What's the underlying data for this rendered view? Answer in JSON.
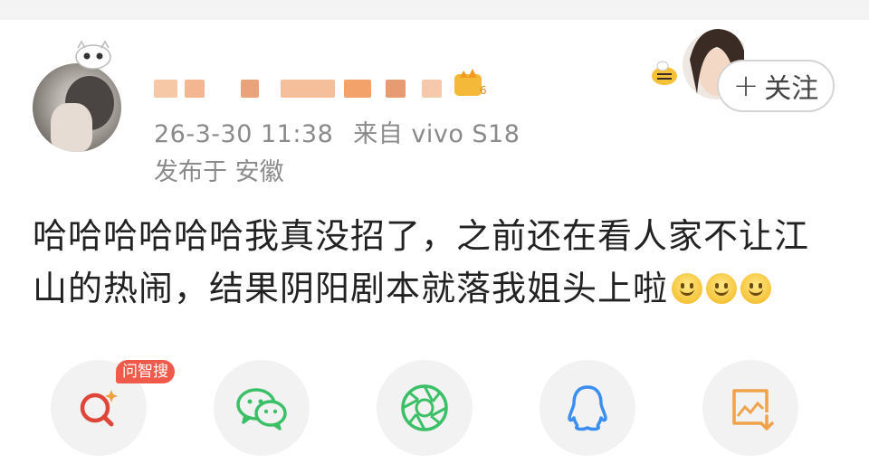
{
  "post": {
    "username_obscured": true,
    "timestamp": "26-3-30 11:38",
    "source": "来自 vivo S18",
    "location": "发布于 安徽",
    "follow_label": "关注",
    "text_line1": "哈哈哈哈哈哈我真没招了，之前还在看人家不让江",
    "text_line2": "山的热闹，结果阴阳剧本就落我姐头上啦",
    "emoji": "smile-emoji"
  },
  "share": {
    "ai_badge": "问智搜",
    "buttons": [
      {
        "name": "ai-search",
        "icon": "magnifier-sparkle-icon",
        "color": "#e0453a"
      },
      {
        "name": "wechat",
        "icon": "wechat-icon",
        "color": "#3bbf67"
      },
      {
        "name": "moments",
        "icon": "aperture-icon",
        "color": "#3bbf67"
      },
      {
        "name": "qq",
        "icon": "qq-penguin-icon",
        "color": "#3a8ef0"
      },
      {
        "name": "save-image",
        "icon": "image-download-icon",
        "color": "#f0a24a"
      }
    ]
  },
  "colors": {
    "meta_gray": "#8a8a8a",
    "badge_red": "#f05a4a",
    "pixel_orange": "#f3a36a"
  }
}
